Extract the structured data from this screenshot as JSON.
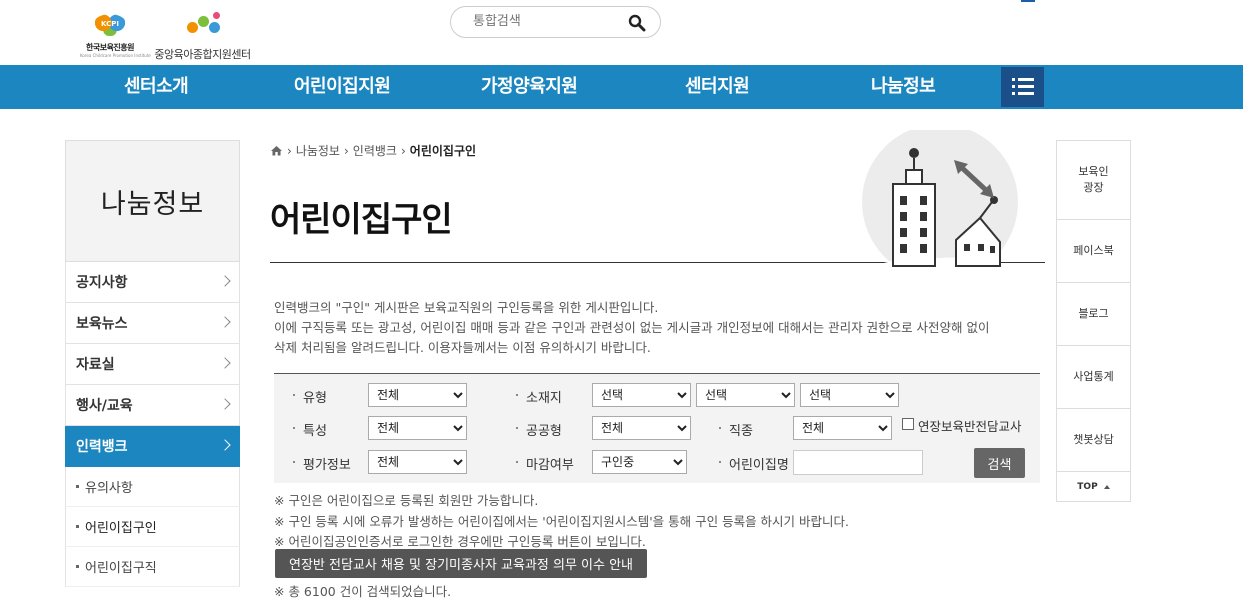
{
  "header": {
    "logo1_abbr": "KCPI",
    "logo1_name": "한국보육진흥원",
    "logo1_sub": "Korea Childcare Promotion Institute",
    "logo2_name": "중앙육아종합지원센터",
    "search_placeholder": "통합검색"
  },
  "nav": {
    "items": [
      "센터소개",
      "어린이집지원",
      "가정양육지원",
      "센터지원",
      "나눔정보"
    ]
  },
  "sidebar": {
    "title": "나눔정보",
    "items": [
      {
        "label": "공지사항"
      },
      {
        "label": "보육뉴스"
      },
      {
        "label": "자료실"
      },
      {
        "label": "행사/교육"
      },
      {
        "label": "인력뱅크"
      }
    ],
    "subitems": [
      "유의사항",
      "어린이집구인",
      "어린이집구직"
    ]
  },
  "breadcrumb": {
    "items": [
      "나눔정보",
      "인력뱅크",
      "어린이집구인"
    ]
  },
  "page": {
    "title": "어린이집구인",
    "desc1": "인력뱅크의 \"구인\" 게시판은 보육교직원의 구인등록을 위한 게시판입니다.",
    "desc2": "이에 구직등록 또는 광고성, 어린이집 매매 등과 같은 구인과 관련성이 없는 게시글과 개인정보에 대해서는 관리자 권한으로 사전양해 없이",
    "desc3": "삭제 처리됨을 알려드립니다. 이용자들께서는 이점 유의하시기 바랍니다."
  },
  "filter": {
    "type_label": "유형",
    "type_value": "전체",
    "location_label": "소재지",
    "location_values": [
      "선택",
      "선택",
      "선택"
    ],
    "feature_label": "특성",
    "feature_value": "전체",
    "public_label": "공공형",
    "public_value": "전체",
    "job_label": "직종",
    "job_value": "전체",
    "extended_checkbox_label": "연장보육반전담교사",
    "eval_label": "평가정보",
    "eval_value": "전체",
    "deadline_label": "마감여부",
    "deadline_value": "구인중",
    "name_label": "어린이집명",
    "search_button": "검색"
  },
  "notes": {
    "n1": "※ 구인은 어린이집으로 등록된 회원만 가능합니다.",
    "n2": "※ 구인 등록 시에 오류가 발생하는 어린이집에서는 '어린이집지원시스템'을 통해 구인 등록을 하시기 바랍니다.",
    "n3": "※ 어린이집공인인증서로 로그인한 경우에만 구인등록 버튼이 보입니다.",
    "notice_button": "연장반 전담교사 채용 및 장기미종사자 교육과정 의무 이수 안내",
    "result": "※ 총 6100 건이 검색되었습니다."
  },
  "quick": {
    "items": [
      "보육인\n광장",
      "페이스북",
      "블로그",
      "사업통계",
      "챗봇상담"
    ],
    "top_label": "TOP"
  },
  "colors": {
    "nav": "#1b86bf",
    "menu": "#1a4f8a",
    "active": "#1b86bf"
  }
}
